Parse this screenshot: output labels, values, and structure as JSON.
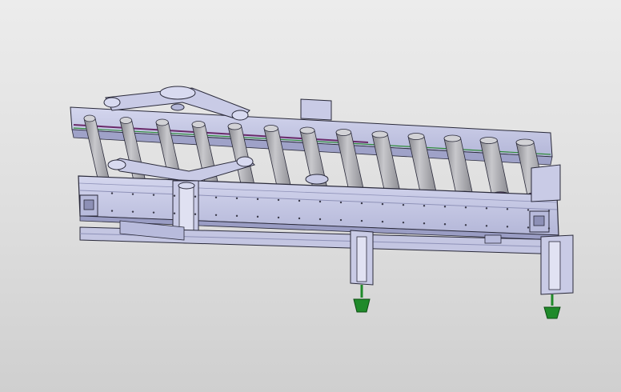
{
  "viewport": {
    "background_top": "#ececec",
    "background_bottom": "#cfcfcf"
  },
  "model": {
    "subject": "roller-conveyor-assembly",
    "frame_color": "#c9cbe6",
    "frame_shadow": "#8f92b8",
    "edge_color": "#2a2a3a",
    "roller_color": "#a4a4a8",
    "roller_highlight": "#d2d2d6",
    "chain_color": "#6a2a6a",
    "rail_accent": "#2e8b3a",
    "foot_color": "#1f8a2a",
    "roller_count": 13,
    "support_leg_count": 2
  }
}
